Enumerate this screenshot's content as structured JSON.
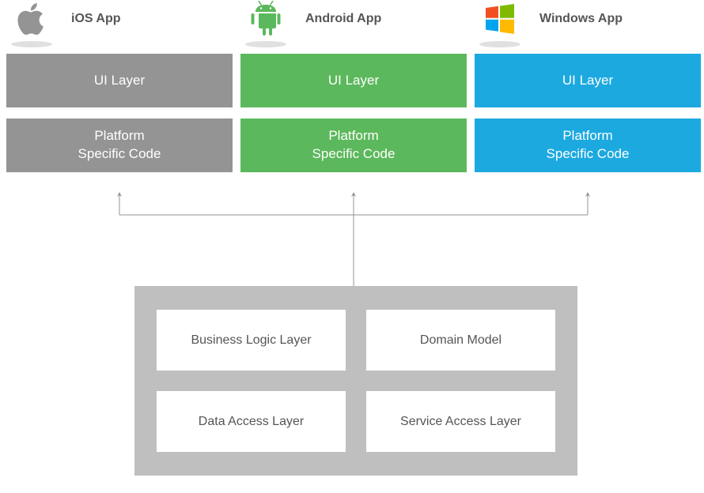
{
  "platforms": {
    "ios": {
      "label": "iOS App",
      "ui_layer": "UI Layer",
      "platform_code": "Platform\nSpecific Code",
      "color": "#949494"
    },
    "android": {
      "label": "Android App",
      "ui_layer": "UI Layer",
      "platform_code": "Platform\nSpecific Code",
      "color": "#5cb85c"
    },
    "windows": {
      "label": "Windows App",
      "ui_layer": "UI Layer",
      "platform_code": "Platform\nSpecific Code",
      "color": "#1ca9e0"
    }
  },
  "shared": {
    "business_logic": "Business Logic Layer",
    "domain_model": "Domain Model",
    "data_access": "Data Access Layer",
    "service_access": "Service Access Layer"
  }
}
